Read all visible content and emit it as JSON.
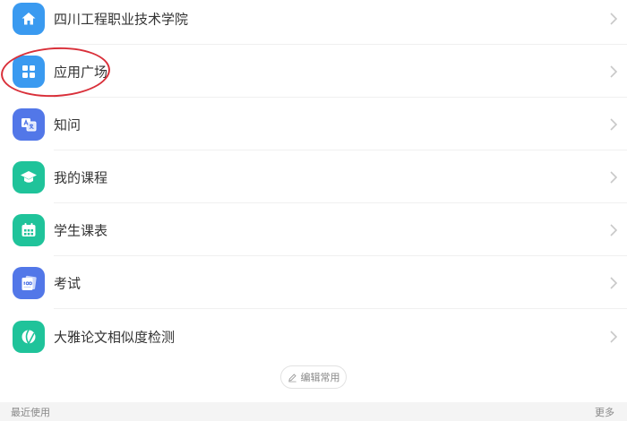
{
  "menu": {
    "items": [
      {
        "label": "四川工程职业技术学院",
        "icon": "home-icon",
        "color": "#3a9af0"
      },
      {
        "label": "应用广场",
        "icon": "grid-apps-icon",
        "color": "#3a9af0"
      },
      {
        "label": "知问",
        "icon": "qa-translate-icon",
        "color": "#5277e8"
      },
      {
        "label": "我的课程",
        "icon": "graduation-cap-icon",
        "color": "#1fc39a"
      },
      {
        "label": "学生课表",
        "icon": "calendar-icon",
        "color": "#1fc39a"
      },
      {
        "label": "考试",
        "icon": "exam-paper-icon",
        "color": "#5277e8"
      },
      {
        "label": "大雅论文相似度检测",
        "icon": "dialog-leaf-icon",
        "color": "#1fc39a"
      }
    ]
  },
  "edit_button": {
    "label": "编辑常用",
    "icon": "pencil-icon"
  },
  "footer": {
    "left": "最近使用",
    "right": "更多"
  },
  "highlight": {
    "color": "#d9303a"
  }
}
